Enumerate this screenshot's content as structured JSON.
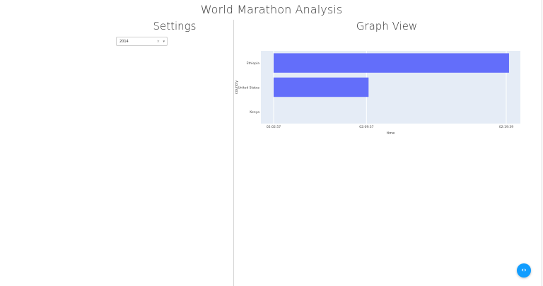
{
  "page": {
    "title": "World Marathon Analysis"
  },
  "settings": {
    "title": "Settings",
    "year_dropdown": {
      "value": "2014",
      "clear_glyph": "×",
      "caret_glyph": "▾"
    }
  },
  "graph": {
    "title": "Graph View"
  },
  "chart_data": {
    "type": "bar",
    "orientation": "horizontal",
    "categories": [
      "Ethiopia",
      "United States",
      "Kenya"
    ],
    "values_seconds": [
      8399,
      7786,
      7377
    ],
    "x_tick_values_seconds": [
      7377,
      7777,
      8379
    ],
    "x_tick_labels": [
      "02:02:57",
      "02:09:37",
      "02:19:39"
    ],
    "xlabel": "time",
    "ylabel": "country",
    "xlim_seconds": [
      7377,
      8379
    ],
    "bar_color": "#636efa",
    "plot_bg": "#e5ecf6",
    "grid": true
  },
  "fab": {
    "icon": "code-brackets-icon",
    "glyph": "‹›"
  }
}
